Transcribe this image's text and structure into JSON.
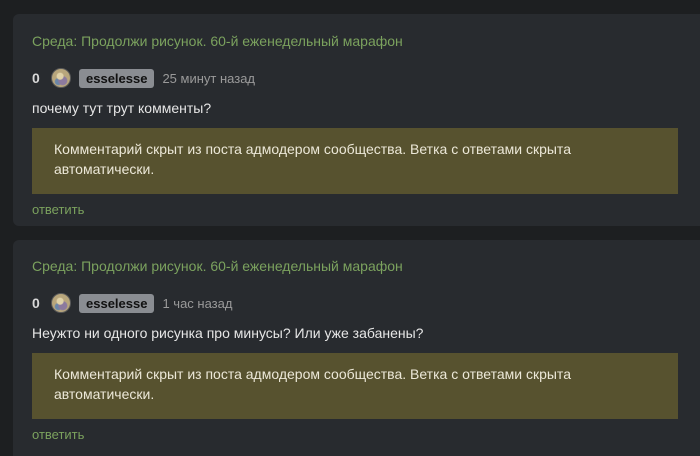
{
  "comments": [
    {
      "post_title": "Среда: Продолжи рисунок. 60-й еженедельный марафон",
      "rating": "0",
      "username": "esselesse",
      "time": "25 минут назад",
      "text": "почему тут трут комменты?",
      "hidden_notice_line1": "Комментарий скрыт из поста адмодером сообщества. Ветка с ответами скрыта",
      "hidden_notice_line2": "автоматически.",
      "reply_label": "ответить"
    },
    {
      "post_title": "Среда: Продолжи рисунок. 60-й еженедельный марафон",
      "rating": "0",
      "username": "esselesse",
      "time": "1 час назад",
      "text": "Неужто ни одного рисунка про минусы? Или уже забанены?",
      "hidden_notice_line1": "Комментарий скрыт из поста адмодером сообщества. Ветка с ответами скрыта",
      "hidden_notice_line2": "автоматически.",
      "reply_label": "ответить"
    }
  ],
  "colors": {
    "background": "#1d1f21",
    "card": "#282b2f",
    "link": "#7ba25e",
    "hidden_box": "#57522f",
    "username_badge": "#8a8d92"
  }
}
